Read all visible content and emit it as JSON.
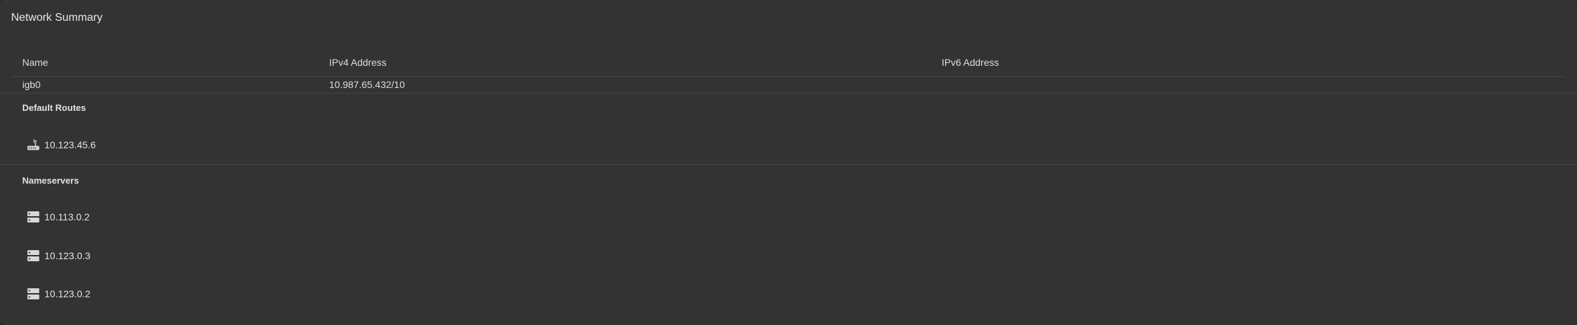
{
  "card": {
    "title": "Network Summary"
  },
  "interfaces": {
    "columns": {
      "name": "Name",
      "ipv4": "IPv4 Address",
      "ipv6": "IPv6 Address"
    },
    "rows": [
      {
        "name": "igb0",
        "ipv4": "10.987.65.432/10",
        "ipv6": ""
      }
    ]
  },
  "default_routes": {
    "title": "Default Routes",
    "items": [
      {
        "address": "10.123.45.6",
        "icon": "router-icon"
      }
    ]
  },
  "nameservers": {
    "title": "Nameservers",
    "items": [
      {
        "address": "10.113.0.2",
        "icon": "server-icon"
      },
      {
        "address": "10.123.0.3",
        "icon": "server-icon"
      },
      {
        "address": "10.123.0.2",
        "icon": "server-icon"
      }
    ]
  }
}
